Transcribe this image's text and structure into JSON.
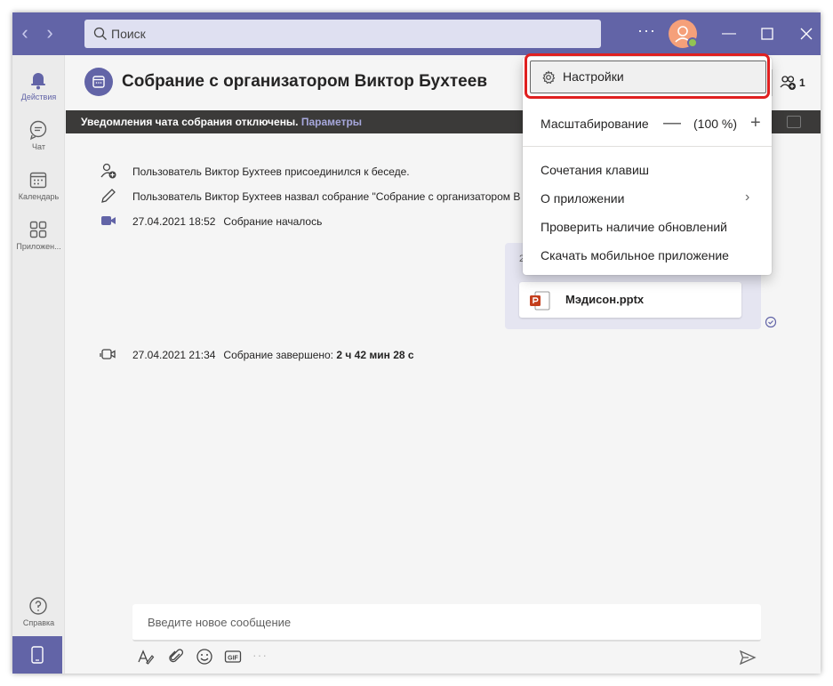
{
  "titlebar": {
    "search_placeholder": "Поиск",
    "more_label": "···",
    "avatar_status": "available",
    "accent": "#6264a7"
  },
  "rail": {
    "items": [
      {
        "label": "Действия",
        "icon": "bell-icon"
      },
      {
        "label": "Чат",
        "icon": "chat-icon"
      },
      {
        "label": "Календарь",
        "icon": "calendar-icon"
      },
      {
        "label": "Приложен...",
        "icon": "apps-icon"
      }
    ],
    "help_label": "Справка",
    "phone_icon": "phone-icon"
  },
  "header": {
    "title": "Собрание с организатором Виктор Бухтеев",
    "participants_count": "1"
  },
  "banner": {
    "text": "Уведомления чата собрания отключены.",
    "link": "Параметры"
  },
  "events": [
    {
      "icon": "user-add-icon",
      "time": "",
      "text": "Пользователь Виктор Бухтеев присоединился к беседе.",
      "bold": ""
    },
    {
      "icon": "pencil-icon",
      "time": "",
      "text": "Пользователь Виктор Бухтеев назвал собрание \"Собрание с организатором В",
      "bold": ""
    },
    {
      "icon": "video-icon",
      "time": "27.04.2021 18:52",
      "text": "Собрание началось",
      "bold": ""
    },
    {
      "icon": "video-end-icon",
      "time": "27.04.2021 21:34",
      "text": "Собрание завершено:",
      "bold": "2 ч 42 мин 28 с"
    }
  ],
  "message": {
    "time_fragment": "2",
    "file_name": "Мэдисон.pptx"
  },
  "compose": {
    "placeholder": "Введите новое сообщение"
  },
  "menu": {
    "settings": "Настройки",
    "zoom_label": "Масштабирование",
    "zoom_minus": "—",
    "zoom_value": "(100 %)",
    "zoom_plus": "+",
    "shortcuts": "Сочетания клавиш",
    "about": "О приложении",
    "check_updates": "Проверить наличие обновлений",
    "download_mobile": "Скачать мобильное приложение"
  }
}
